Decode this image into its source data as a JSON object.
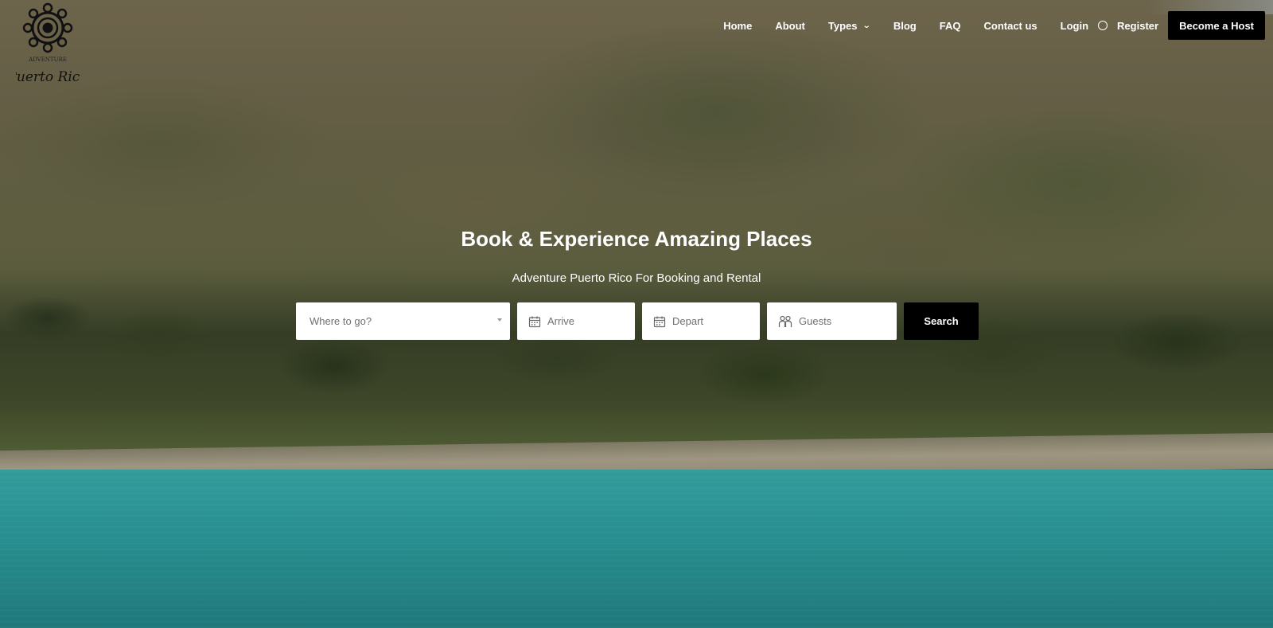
{
  "brand": {
    "logo_top_text": "ADVENTURE",
    "logo_script_text": "Puerto Rico",
    "logo_icon": "sun-emblem-icon"
  },
  "nav": {
    "items": [
      {
        "label": "Home"
      },
      {
        "label": "About"
      },
      {
        "label": "Types",
        "icon": "chevron-down-icon"
      },
      {
        "label": "Blog"
      },
      {
        "label": "FAQ"
      },
      {
        "label": "Contact us"
      }
    ],
    "login_label": "Login",
    "register_label": "Register",
    "user_icon": "user-circle-icon",
    "host_button_label": "Become a Host"
  },
  "hero": {
    "headline": "Book & Experience Amazing Places",
    "subheadline": "Adventure Puerto Rico For Booking and Rental"
  },
  "search": {
    "where_placeholder": "Where to go?",
    "arrive_placeholder": "Arrive",
    "depart_placeholder": "Depart",
    "guests_placeholder": "Guests",
    "button_label": "Search",
    "calendar_icon": "calendar-icon",
    "guests_icon": "people-icon"
  },
  "colors": {
    "button_bg": "#000000",
    "text_on_dark": "#ffffff",
    "placeholder": "#707070"
  }
}
